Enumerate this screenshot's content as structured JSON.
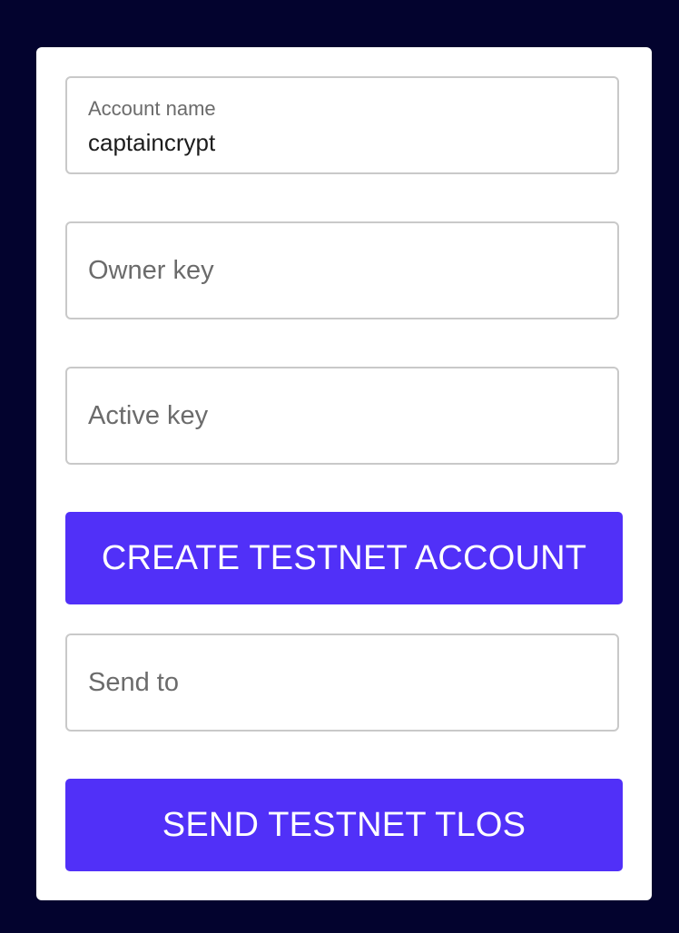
{
  "form": {
    "account_name": {
      "label": "Account name",
      "value": "captaincrypt"
    },
    "owner_key": {
      "placeholder": "Owner key",
      "value": ""
    },
    "active_key": {
      "placeholder": "Active key",
      "value": ""
    },
    "create_button_label": "CREATE TESTNET ACCOUNT",
    "send_to": {
      "placeholder": "Send to",
      "value": ""
    },
    "send_button_label": "SEND TESTNET TLOS"
  },
  "colors": {
    "background": "#03032e",
    "card": "#ffffff",
    "accent": "#5130f8",
    "field_border": "#c9c9c9",
    "placeholder_text": "#6b6b6b"
  }
}
